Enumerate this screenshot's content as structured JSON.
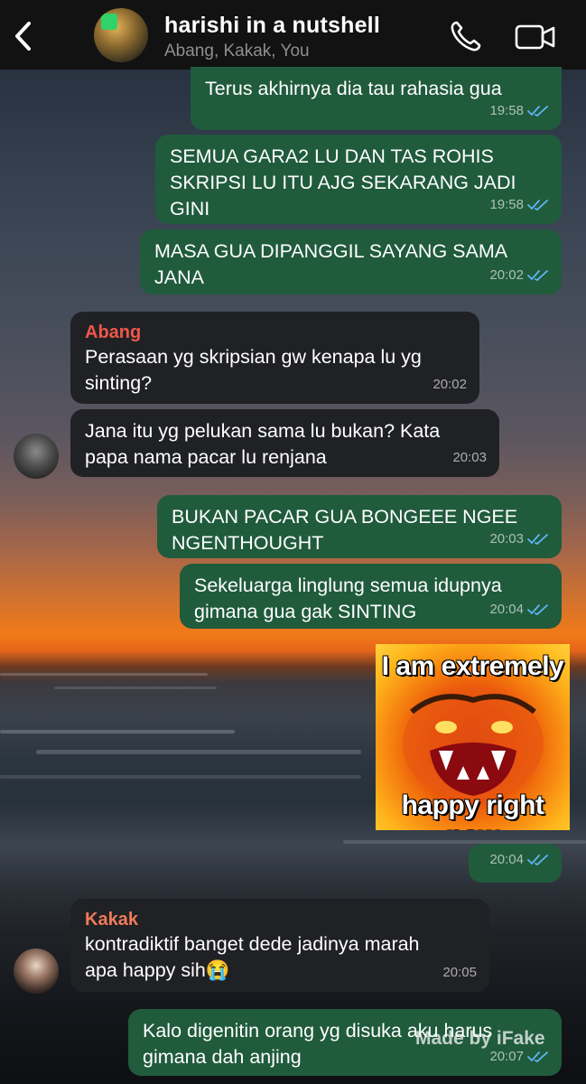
{
  "header": {
    "title": "harishi in a nutshell",
    "subtitle": "Abang, Kakak, You",
    "back_icon": "chevron-left-icon",
    "call_icon": "phone-icon",
    "video_icon": "video-camera-icon"
  },
  "messages": [
    {
      "direction": "out",
      "text": "Terus akhirnya dia tau rahasia gua",
      "time": "19:58",
      "status": "read"
    },
    {
      "direction": "out",
      "text": "SEMUA GARA2 LU DAN TAS ROHIS\nSKRIPSI LU ITU AJG SEKARANG JADI\nGINI",
      "time": "19:58",
      "status": "read"
    },
    {
      "direction": "out",
      "text": "MASA GUA DIPANGGIL SAYANG SAMA\nJANA",
      "time": "20:02",
      "status": "read"
    },
    {
      "direction": "in",
      "sender": "Abang",
      "text": "Perasaan yg skripsian gw kenapa lu yg\nsinting?",
      "time": "20:02"
    },
    {
      "direction": "in",
      "text": "Jana itu yg pelukan sama lu bukan? Kata\npapa nama pacar lu renjana",
      "time": "20:03"
    },
    {
      "direction": "out",
      "text": "BUKAN PACAR GUA BONGEEE NGEE\nNGENTHOUGHT",
      "time": "20:03",
      "status": "read"
    },
    {
      "direction": "out",
      "text": "Sekeluarga linglung semua idupnya\ngimana gua gak SINTING",
      "time": "20:04",
      "status": "read"
    },
    {
      "direction": "out",
      "sticker_top": "I am extremely",
      "sticker_bottom": "happy right now",
      "time": "20:04",
      "status": "read"
    },
    {
      "direction": "in",
      "sender": "Kakak",
      "text": "kontradiktif banget dede jadinya marah\napa happy sih😭",
      "time": "20:05"
    },
    {
      "direction": "out",
      "text": "Kalo digenitin orang yg disuka aku harus\ngimana dah anjing",
      "time": "20:07",
      "status": "read"
    }
  ],
  "watermark": "Made by iFake",
  "colors": {
    "outgoing_bubble": "#205b3c",
    "incoming_bubble": "#202124",
    "sender_abang": "#f0564a",
    "sender_kakak": "#f07a5a",
    "read_ticks": "#5fb6f5"
  }
}
